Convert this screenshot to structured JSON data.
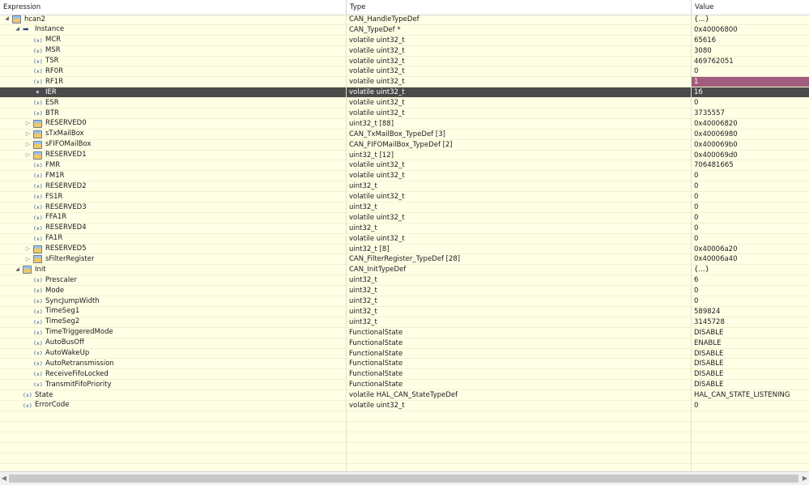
{
  "columns": {
    "expression": "Expression",
    "type": "Type",
    "value": "Value"
  },
  "colors": {
    "selected_row": "#4a4a4a",
    "changed_value": "#a15d7e",
    "background": "#ffffe6"
  },
  "rows": [
    {
      "depth": 0,
      "toggle": "open",
      "icon": "struct-icon",
      "name": "hcan2",
      "type": "CAN_HandleTypeDef",
      "value": "{...}"
    },
    {
      "depth": 1,
      "toggle": "open",
      "icon": "pointer-arrow-icon",
      "name": "Instance",
      "type": "CAN_TypeDef *",
      "value": "0x40006800"
    },
    {
      "depth": 2,
      "toggle": "none",
      "icon": "variable-icon",
      "name": "MCR",
      "type": "volatile uint32_t",
      "value": "65616"
    },
    {
      "depth": 2,
      "toggle": "none",
      "icon": "variable-icon",
      "name": "MSR",
      "type": "volatile uint32_t",
      "value": "3080"
    },
    {
      "depth": 2,
      "toggle": "none",
      "icon": "variable-icon",
      "name": "TSR",
      "type": "volatile uint32_t",
      "value": "469762051"
    },
    {
      "depth": 2,
      "toggle": "none",
      "icon": "variable-icon",
      "name": "RF0R",
      "type": "volatile uint32_t",
      "value": "0"
    },
    {
      "depth": 2,
      "toggle": "none",
      "icon": "variable-icon",
      "name": "RF1R",
      "type": "volatile uint32_t",
      "value": "1",
      "changed": true
    },
    {
      "depth": 2,
      "toggle": "none",
      "icon": "x-variable-icon",
      "name": "IER",
      "type": "volatile uint32_t",
      "value": "16",
      "selected": true
    },
    {
      "depth": 2,
      "toggle": "none",
      "icon": "variable-icon",
      "name": "ESR",
      "type": "volatile uint32_t",
      "value": "0"
    },
    {
      "depth": 2,
      "toggle": "none",
      "icon": "variable-icon",
      "name": "BTR",
      "type": "volatile uint32_t",
      "value": "3735557"
    },
    {
      "depth": 2,
      "toggle": "closed",
      "icon": "struct-icon",
      "name": "RESERVED0",
      "type": "uint32_t [88]",
      "value": "0x40006820"
    },
    {
      "depth": 2,
      "toggle": "closed",
      "icon": "struct-icon",
      "name": "sTxMailBox",
      "type": "CAN_TxMailBox_TypeDef [3]",
      "value": "0x40006980"
    },
    {
      "depth": 2,
      "toggle": "closed",
      "icon": "struct-icon",
      "name": "sFIFOMailBox",
      "type": "CAN_FIFOMailBox_TypeDef [2]",
      "value": "0x400069b0"
    },
    {
      "depth": 2,
      "toggle": "closed",
      "icon": "struct-icon",
      "name": "RESERVED1",
      "type": "uint32_t [12]",
      "value": "0x400069d0"
    },
    {
      "depth": 2,
      "toggle": "none",
      "icon": "variable-icon",
      "name": "FMR",
      "type": "volatile uint32_t",
      "value": "706481665"
    },
    {
      "depth": 2,
      "toggle": "none",
      "icon": "variable-icon",
      "name": "FM1R",
      "type": "volatile uint32_t",
      "value": "0"
    },
    {
      "depth": 2,
      "toggle": "none",
      "icon": "variable-icon",
      "name": "RESERVED2",
      "type": "uint32_t",
      "value": "0"
    },
    {
      "depth": 2,
      "toggle": "none",
      "icon": "variable-icon",
      "name": "FS1R",
      "type": "volatile uint32_t",
      "value": "0"
    },
    {
      "depth": 2,
      "toggle": "none",
      "icon": "variable-icon",
      "name": "RESERVED3",
      "type": "uint32_t",
      "value": "0"
    },
    {
      "depth": 2,
      "toggle": "none",
      "icon": "variable-icon",
      "name": "FFA1R",
      "type": "volatile uint32_t",
      "value": "0"
    },
    {
      "depth": 2,
      "toggle": "none",
      "icon": "variable-icon",
      "name": "RESERVED4",
      "type": "uint32_t",
      "value": "0"
    },
    {
      "depth": 2,
      "toggle": "none",
      "icon": "variable-icon",
      "name": "FA1R",
      "type": "volatile uint32_t",
      "value": "0"
    },
    {
      "depth": 2,
      "toggle": "closed",
      "icon": "struct-icon",
      "name": "RESERVED5",
      "type": "uint32_t [8]",
      "value": "0x40006a20"
    },
    {
      "depth": 2,
      "toggle": "closed",
      "icon": "struct-icon",
      "name": "sFilterRegister",
      "type": "CAN_FilterRegister_TypeDef [28]",
      "value": "0x40006a40"
    },
    {
      "depth": 1,
      "toggle": "open",
      "icon": "struct-icon",
      "name": "Init",
      "type": "CAN_InitTypeDef",
      "value": "{...}"
    },
    {
      "depth": 2,
      "toggle": "none",
      "icon": "variable-icon",
      "name": "Prescaler",
      "type": "uint32_t",
      "value": "6"
    },
    {
      "depth": 2,
      "toggle": "none",
      "icon": "variable-icon",
      "name": "Mode",
      "type": "uint32_t",
      "value": "0"
    },
    {
      "depth": 2,
      "toggle": "none",
      "icon": "variable-icon",
      "name": "SyncJumpWidth",
      "type": "uint32_t",
      "value": "0"
    },
    {
      "depth": 2,
      "toggle": "none",
      "icon": "variable-icon",
      "name": "TimeSeg1",
      "type": "uint32_t",
      "value": "589824"
    },
    {
      "depth": 2,
      "toggle": "none",
      "icon": "variable-icon",
      "name": "TimeSeg2",
      "type": "uint32_t",
      "value": "3145728"
    },
    {
      "depth": 2,
      "toggle": "none",
      "icon": "variable-icon",
      "name": "TimeTriggeredMode",
      "type": "FunctionalState",
      "value": "DISABLE"
    },
    {
      "depth": 2,
      "toggle": "none",
      "icon": "variable-icon",
      "name": "AutoBusOff",
      "type": "FunctionalState",
      "value": "ENABLE"
    },
    {
      "depth": 2,
      "toggle": "none",
      "icon": "variable-icon",
      "name": "AutoWakeUp",
      "type": "FunctionalState",
      "value": "DISABLE"
    },
    {
      "depth": 2,
      "toggle": "none",
      "icon": "variable-icon",
      "name": "AutoRetransmission",
      "type": "FunctionalState",
      "value": "DISABLE"
    },
    {
      "depth": 2,
      "toggle": "none",
      "icon": "variable-icon",
      "name": "ReceiveFifoLocked",
      "type": "FunctionalState",
      "value": "DISABLE"
    },
    {
      "depth": 2,
      "toggle": "none",
      "icon": "variable-icon",
      "name": "TransmitFifoPriority",
      "type": "FunctionalState",
      "value": "DISABLE"
    },
    {
      "depth": 1,
      "toggle": "none",
      "icon": "variable-icon",
      "name": "State",
      "type": "volatile HAL_CAN_StateTypeDef",
      "value": "HAL_CAN_STATE_LISTENING"
    },
    {
      "depth": 1,
      "toggle": "none",
      "icon": "variable-icon",
      "name": "ErrorCode",
      "type": "volatile uint32_t",
      "value": "0"
    }
  ]
}
